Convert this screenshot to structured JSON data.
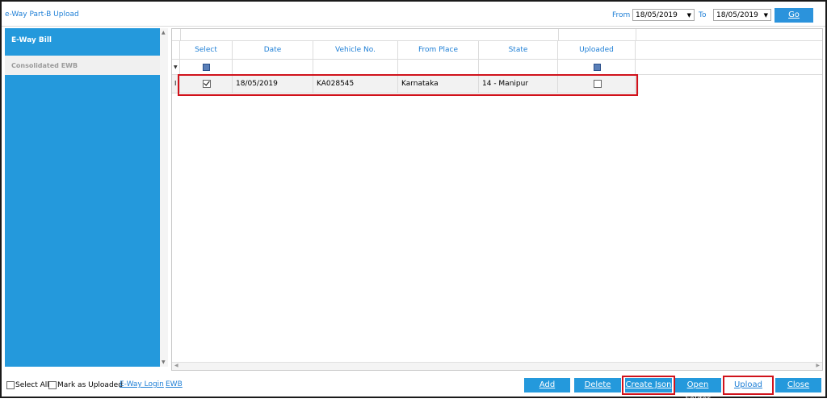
{
  "window": {
    "title": "e-Way Part-B Upload"
  },
  "filter": {
    "from_label": "From",
    "from_value": "18/05/2019",
    "to_label": "To",
    "to_value": "18/05/2019",
    "go_label": "Go"
  },
  "sidebar": {
    "items": [
      {
        "label": "E-Way Bill",
        "active": true
      },
      {
        "label": "Consolidated EWB",
        "active": false
      }
    ]
  },
  "grid": {
    "columns": [
      "Select",
      "Date",
      "Vehicle No.",
      "From Place",
      "State",
      "Uploaded"
    ],
    "filter_row_marker": "▼",
    "current_row_marker": "I",
    "rows": [
      {
        "select": true,
        "date": "18/05/2019",
        "vehicle_no": "KA028545",
        "from_place": "Karnataka",
        "state": "14 - Manipur",
        "uploaded": false
      }
    ]
  },
  "footer": {
    "select_all_label": "Select All",
    "mark_uploaded_label": "Mark as Uploaded",
    "eway_login_link": "E-Way Login",
    "ewb_link": "EWB"
  },
  "buttons": {
    "add": "Add",
    "delete": "Delete",
    "create_json": "Create Json",
    "open_folder": "Open Folder",
    "upload": "Upload",
    "close": "Close"
  },
  "colors": {
    "accent": "#2499dc",
    "highlight": "#d0121b",
    "link": "#1e7fd6"
  }
}
